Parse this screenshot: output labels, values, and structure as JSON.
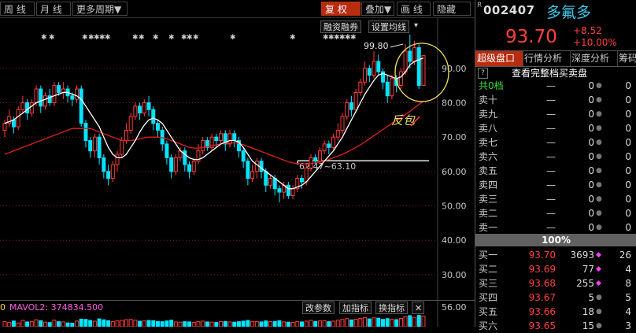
{
  "toolbar": {
    "left": [
      "周 线",
      "月 线",
      "更多周期▼"
    ],
    "right": [
      "复 权",
      "叠加▼",
      "画 线",
      "隐藏"
    ],
    "active_right": "复 权"
  },
  "chart_controls": {
    "margin_btn": "融资融券",
    "ma_btn": "设置均线",
    "high_label": "99.80",
    "range_label": "62.47~63.10",
    "annotation": "反包"
  },
  "volume": {
    "left_label": "0",
    "mavol_label": "MAVOL2: 374834.500",
    "buttons": [
      "改参数",
      "加指标",
      "换指标"
    ],
    "close": "✕",
    "axis_label": "56.00"
  },
  "axis": {
    "ticks": [
      90.0,
      80.0,
      70.0,
      60.0,
      50.0,
      40.0,
      30.0
    ],
    "ymin": 27,
    "ymax": 103
  },
  "quote": {
    "r_mark": "R",
    "code": "002407",
    "name": "多氟多",
    "price": "93.70",
    "change": "+8.52",
    "change_pct": "+10.00%",
    "tabs": [
      "超级盘口",
      "行情分析",
      "深度分析",
      "筹码"
    ],
    "active_tab": "超级盘口",
    "help_icon": "?",
    "see_full": "查看完整档买卖盘",
    "summary": {
      "label": "共0档",
      "price": "—",
      "vol": "0",
      "cnt": "0"
    },
    "asks": [
      {
        "label": "卖十",
        "price": "—",
        "vol": "0",
        "cnt": "0"
      },
      {
        "label": "卖九",
        "price": "—",
        "vol": "0",
        "cnt": "0"
      },
      {
        "label": "卖八",
        "price": "—",
        "vol": "0",
        "cnt": "0"
      },
      {
        "label": "卖七",
        "price": "—",
        "vol": "0",
        "cnt": "0"
      },
      {
        "label": "卖六",
        "price": "—",
        "vol": "0",
        "cnt": "0"
      },
      {
        "label": "卖五",
        "price": "—",
        "vol": "0",
        "cnt": "0"
      },
      {
        "label": "卖四",
        "price": "—",
        "vol": "0",
        "cnt": "0"
      },
      {
        "label": "卖三",
        "price": "—",
        "vol": "0",
        "cnt": "0"
      },
      {
        "label": "卖二",
        "price": "—",
        "vol": "0",
        "cnt": "0"
      },
      {
        "label": "卖一",
        "price": "—",
        "vol": "0",
        "cnt": "0"
      }
    ],
    "bar_pct": "100%",
    "bids": [
      {
        "label": "买一",
        "price": "93.70",
        "vol": "3693",
        "cnt": "26",
        "mark": true
      },
      {
        "label": "买二",
        "price": "93.69",
        "vol": "77",
        "cnt": "4",
        "mark": true
      },
      {
        "label": "买三",
        "price": "93.68",
        "vol": "255",
        "cnt": "8",
        "mark": true
      },
      {
        "label": "买四",
        "price": "93.67",
        "vol": "5",
        "cnt": "5",
        "mark": false
      },
      {
        "label": "买五",
        "price": "93.66",
        "vol": "18",
        "cnt": "4",
        "mark": false
      },
      {
        "label": "买六",
        "price": "93.65",
        "vol": "15",
        "cnt": "3",
        "mark": false
      }
    ]
  },
  "colors": {
    "up": "#ff3c3c",
    "down": "#00e4ff",
    "ma_short": "#ffffff",
    "ma_long": "#e02020",
    "circle": "#f0e060",
    "grid": "#7a2020",
    "accent": "#b82c10"
  },
  "chart_data": {
    "type": "candlestick",
    "title": "",
    "ylim": [
      27,
      103
    ],
    "y_ticks": [
      90,
      80,
      70,
      60,
      50,
      40,
      30
    ],
    "candles": [
      {
        "o": 72,
        "c": 74,
        "h": 75,
        "l": 70
      },
      {
        "o": 74,
        "c": 76,
        "h": 78,
        "l": 73
      },
      {
        "o": 75,
        "c": 73,
        "h": 76,
        "l": 71
      },
      {
        "o": 73,
        "c": 78,
        "h": 79,
        "l": 72
      },
      {
        "o": 78,
        "c": 80,
        "h": 82,
        "l": 77
      },
      {
        "o": 80,
        "c": 77,
        "h": 81,
        "l": 75
      },
      {
        "o": 77,
        "c": 80,
        "h": 81,
        "l": 76
      },
      {
        "o": 80,
        "c": 84,
        "h": 85,
        "l": 79
      },
      {
        "o": 84,
        "c": 79,
        "h": 85,
        "l": 77
      },
      {
        "o": 79,
        "c": 82,
        "h": 83,
        "l": 78
      },
      {
        "o": 82,
        "c": 80,
        "h": 84,
        "l": 79
      },
      {
        "o": 80,
        "c": 85,
        "h": 86,
        "l": 79
      },
      {
        "o": 85,
        "c": 83,
        "h": 86,
        "l": 82
      },
      {
        "o": 83,
        "c": 84,
        "h": 86,
        "l": 81
      },
      {
        "o": 84,
        "c": 82,
        "h": 85,
        "l": 80
      },
      {
        "o": 82,
        "c": 81,
        "h": 83,
        "l": 79
      },
      {
        "o": 81,
        "c": 84,
        "h": 85,
        "l": 80
      },
      {
        "o": 84,
        "c": 74,
        "h": 85,
        "l": 73
      },
      {
        "o": 74,
        "c": 69,
        "h": 75,
        "l": 67
      },
      {
        "o": 69,
        "c": 66,
        "h": 70,
        "l": 64
      },
      {
        "o": 66,
        "c": 70,
        "h": 71,
        "l": 64
      },
      {
        "o": 70,
        "c": 64,
        "h": 71,
        "l": 62
      },
      {
        "o": 64,
        "c": 60,
        "h": 65,
        "l": 58
      },
      {
        "o": 60,
        "c": 58,
        "h": 62,
        "l": 56
      },
      {
        "o": 58,
        "c": 62,
        "h": 63,
        "l": 57
      },
      {
        "o": 62,
        "c": 65,
        "h": 66,
        "l": 60
      },
      {
        "o": 65,
        "c": 69,
        "h": 70,
        "l": 64
      },
      {
        "o": 69,
        "c": 72,
        "h": 74,
        "l": 68
      },
      {
        "o": 72,
        "c": 76,
        "h": 77,
        "l": 71
      },
      {
        "o": 76,
        "c": 79,
        "h": 80,
        "l": 75
      },
      {
        "o": 79,
        "c": 77,
        "h": 80,
        "l": 75
      },
      {
        "o": 77,
        "c": 80,
        "h": 81,
        "l": 76
      },
      {
        "o": 80,
        "c": 78,
        "h": 82,
        "l": 76
      },
      {
        "o": 78,
        "c": 74,
        "h": 79,
        "l": 72
      },
      {
        "o": 74,
        "c": 72,
        "h": 75,
        "l": 70
      },
      {
        "o": 72,
        "c": 68,
        "h": 73,
        "l": 66
      },
      {
        "o": 68,
        "c": 64,
        "h": 69,
        "l": 62
      },
      {
        "o": 64,
        "c": 60,
        "h": 65,
        "l": 58
      },
      {
        "o": 60,
        "c": 64,
        "h": 65,
        "l": 59
      },
      {
        "o": 64,
        "c": 66,
        "h": 67,
        "l": 63
      },
      {
        "o": 66,
        "c": 62,
        "h": 67,
        "l": 60
      },
      {
        "o": 62,
        "c": 60,
        "h": 63,
        "l": 58
      },
      {
        "o": 60,
        "c": 63,
        "h": 64,
        "l": 59
      },
      {
        "o": 63,
        "c": 66,
        "h": 68,
        "l": 62
      },
      {
        "o": 66,
        "c": 69,
        "h": 70,
        "l": 65
      },
      {
        "o": 69,
        "c": 67,
        "h": 70,
        "l": 66
      },
      {
        "o": 67,
        "c": 70,
        "h": 71,
        "l": 66
      },
      {
        "o": 70,
        "c": 69,
        "h": 71,
        "l": 67
      },
      {
        "o": 69,
        "c": 71,
        "h": 72,
        "l": 68
      },
      {
        "o": 71,
        "c": 68,
        "h": 72,
        "l": 66
      },
      {
        "o": 68,
        "c": 71,
        "h": 72,
        "l": 67
      },
      {
        "o": 71,
        "c": 69,
        "h": 72,
        "l": 67
      },
      {
        "o": 69,
        "c": 66,
        "h": 70,
        "l": 64
      },
      {
        "o": 66,
        "c": 63,
        "h": 67,
        "l": 61
      },
      {
        "o": 63,
        "c": 58,
        "h": 64,
        "l": 56
      },
      {
        "o": 58,
        "c": 60,
        "h": 62,
        "l": 57
      },
      {
        "o": 60,
        "c": 63,
        "h": 64,
        "l": 58
      },
      {
        "o": 63,
        "c": 60,
        "h": 64,
        "l": 58
      },
      {
        "o": 60,
        "c": 56,
        "h": 61,
        "l": 54
      },
      {
        "o": 56,
        "c": 58,
        "h": 59,
        "l": 55
      },
      {
        "o": 58,
        "c": 55,
        "h": 59,
        "l": 53
      },
      {
        "o": 55,
        "c": 54,
        "h": 56,
        "l": 51
      },
      {
        "o": 54,
        "c": 56,
        "h": 57,
        "l": 52
      },
      {
        "o": 56,
        "c": 53,
        "h": 57,
        "l": 52
      },
      {
        "o": 53,
        "c": 55,
        "h": 56,
        "l": 52
      },
      {
        "o": 55,
        "c": 58,
        "h": 59,
        "l": 54
      },
      {
        "o": 58,
        "c": 57,
        "h": 59,
        "l": 55
      },
      {
        "o": 57,
        "c": 61,
        "h": 62,
        "l": 56
      },
      {
        "o": 61,
        "c": 64,
        "h": 65,
        "l": 60
      },
      {
        "o": 64,
        "c": 63,
        "h": 65,
        "l": 62
      },
      {
        "o": 63,
        "c": 66,
        "h": 67,
        "l": 62
      },
      {
        "o": 66,
        "c": 68,
        "h": 69,
        "l": 65
      },
      {
        "o": 68,
        "c": 67,
        "h": 69,
        "l": 65
      },
      {
        "o": 67,
        "c": 70,
        "h": 71,
        "l": 66
      },
      {
        "o": 70,
        "c": 72,
        "h": 74,
        "l": 69
      },
      {
        "o": 72,
        "c": 76,
        "h": 77,
        "l": 71
      },
      {
        "o": 76,
        "c": 80,
        "h": 81,
        "l": 75
      },
      {
        "o": 80,
        "c": 78,
        "h": 82,
        "l": 76
      },
      {
        "o": 78,
        "c": 83,
        "h": 84,
        "l": 77
      },
      {
        "o": 83,
        "c": 86,
        "h": 87,
        "l": 82
      },
      {
        "o": 86,
        "c": 90,
        "h": 92,
        "l": 85
      },
      {
        "o": 90,
        "c": 88,
        "h": 91,
        "l": 86
      },
      {
        "o": 88,
        "c": 92,
        "h": 95,
        "l": 87
      },
      {
        "o": 92,
        "c": 89,
        "h": 94,
        "l": 88
      },
      {
        "o": 89,
        "c": 86,
        "h": 90,
        "l": 84
      },
      {
        "o": 86,
        "c": 82,
        "h": 88,
        "l": 80
      },
      {
        "o": 82,
        "c": 87,
        "h": 88,
        "l": 81
      },
      {
        "o": 87,
        "c": 85,
        "h": 88,
        "l": 83
      },
      {
        "o": 85,
        "c": 89,
        "h": 90,
        "l": 84
      },
      {
        "o": 89,
        "c": 95,
        "h": 97,
        "l": 88
      },
      {
        "o": 95,
        "c": 92,
        "h": 99.8,
        "l": 90
      },
      {
        "o": 92,
        "c": 96,
        "h": 98,
        "l": 91
      },
      {
        "o": 96,
        "c": 85,
        "h": 97,
        "l": 84
      },
      {
        "o": 85,
        "c": 93.7,
        "h": 93.7,
        "l": 85
      }
    ],
    "ma_short": [
      74,
      74.5,
      75,
      76,
      77,
      78,
      79,
      80,
      80.5,
      81,
      81.5,
      82,
      82.5,
      83,
      83,
      82.5,
      82,
      81,
      79,
      77,
      75,
      73,
      70,
      67,
      65,
      64,
      64,
      65,
      67,
      69,
      71.5,
      73.5,
      75,
      75.5,
      75,
      74,
      72,
      70,
      68,
      66,
      65,
      64,
      63.5,
      63.5,
      64,
      65,
      66,
      67,
      68,
      68.5,
      69,
      69,
      68.5,
      67,
      65,
      63,
      62,
      61,
      60,
      59,
      58,
      57,
      56,
      55,
      55,
      55.5,
      56,
      57,
      58.5,
      60,
      61.5,
      63,
      64.5,
      66,
      68,
      70,
      72.5,
      75,
      77.5,
      80,
      82.5,
      84.5,
      86.5,
      88,
      88.5,
      88,
      87.5,
      87,
      87.5,
      89,
      91,
      92,
      92.5,
      93
    ],
    "ma_long": [
      65,
      65.5,
      66,
      66.5,
      67,
      67.5,
      68,
      68.5,
      69,
      69.5,
      70,
      70.5,
      71,
      71.5,
      72,
      72.5,
      72.5,
      72.5,
      72.5,
      72.5,
      72,
      71.5,
      71,
      70.5,
      70,
      69.5,
      69,
      69,
      69,
      69.2,
      69.5,
      69.8,
      70,
      70,
      70,
      69.8,
      69.5,
      69,
      68.5,
      68,
      67.5,
      67,
      66.8,
      66.8,
      67,
      67.2,
      67.5,
      67.8,
      68,
      68.2,
      68.3,
      68.3,
      68.2,
      67.8,
      67.3,
      66.8,
      66.3,
      65.8,
      65.3,
      64.8,
      64.3,
      63.8,
      63.3,
      62.8,
      62.5,
      62.3,
      62.2,
      62.2,
      62.3,
      62.5,
      62.8,
      63.1,
      63.5,
      64,
      64.5,
      65,
      65.6,
      66.3,
      67,
      67.8,
      68.6,
      69.5,
      70.4,
      71.3,
      72.2,
      73.1,
      74,
      74.8,
      75.6,
      76.6,
      77.5,
      78.5,
      79.5,
      80.5
    ],
    "volumes": [
      40,
      35,
      45,
      30,
      50,
      38,
      42,
      55,
      48,
      36,
      33,
      52,
      40,
      38,
      30,
      28,
      45,
      60,
      58,
      50,
      44,
      62,
      55,
      48,
      40,
      46,
      50,
      56,
      58,
      52,
      44,
      46,
      50,
      48,
      42,
      40,
      46,
      52,
      38,
      36,
      40,
      38,
      34,
      40,
      44,
      38,
      36,
      34,
      40,
      42,
      38,
      36,
      40,
      44,
      50,
      42,
      40,
      38,
      46,
      40,
      42,
      48,
      38,
      36,
      34,
      40,
      38,
      44,
      50,
      42,
      46,
      48,
      40,
      44,
      52,
      58,
      64,
      54,
      60,
      66,
      72,
      62,
      70,
      68,
      58,
      64,
      60,
      56,
      66,
      80,
      88,
      74,
      90,
      85
    ],
    "volume_ylim": [
      0,
      100
    ]
  }
}
